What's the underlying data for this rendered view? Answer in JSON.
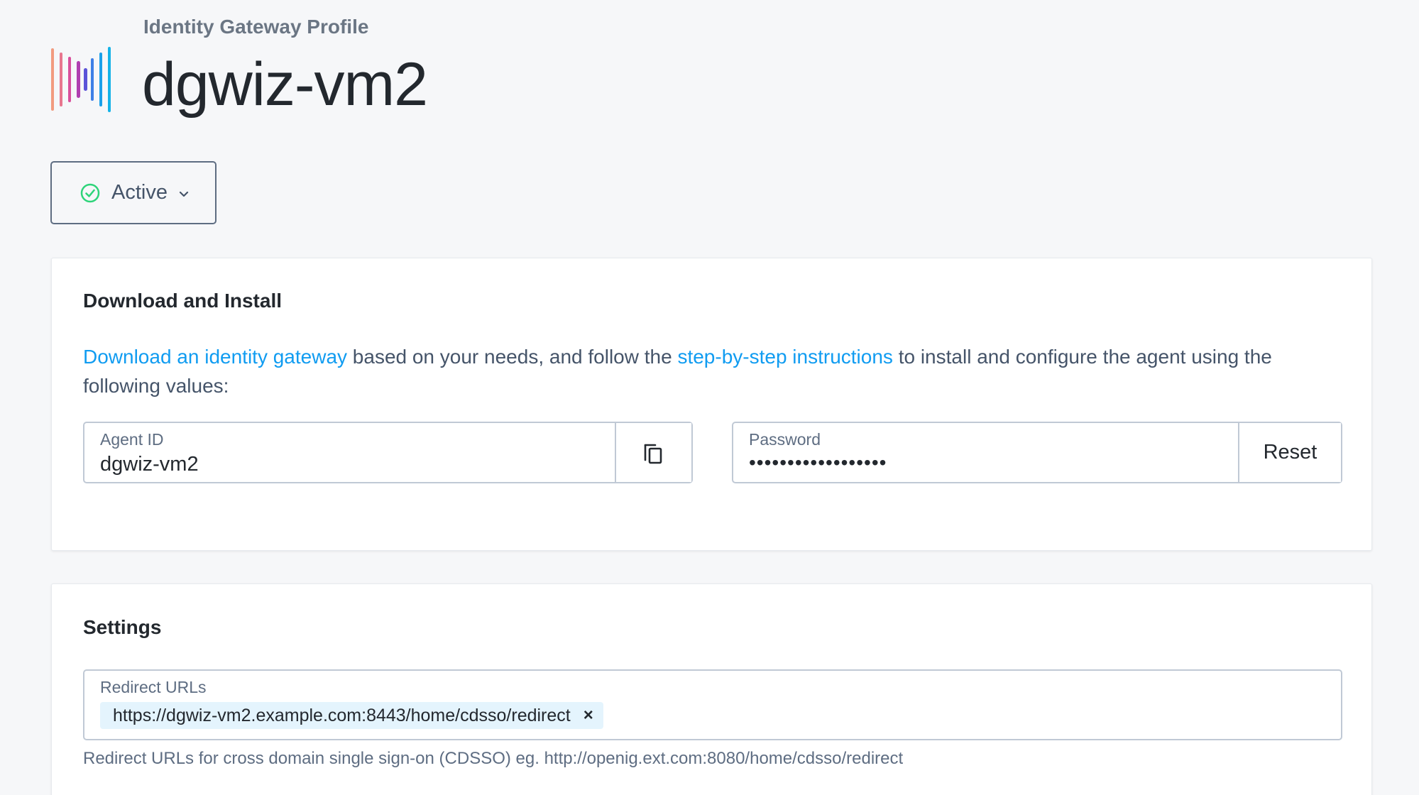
{
  "header": {
    "subtitle": "Identity Gateway Profile",
    "title": "dgwiz-vm2",
    "logo_icon": "forgerock-logo-icon"
  },
  "status": {
    "label": "Active",
    "icon": "check-circle-icon",
    "icon_color": "#2ed47a",
    "dropdown_icon": "chevron-down-icon"
  },
  "download_card": {
    "title": "Download and Install",
    "description": {
      "link1": "Download an identity gateway",
      "text1": " based on your needs, and follow the ",
      "link2": "step-by-step instructions",
      "text2": " to install and configure the agent using the following values:"
    },
    "agent_id": {
      "label": "Agent ID",
      "value": "dgwiz-vm2",
      "copy_icon": "copy-icon"
    },
    "password": {
      "label": "Password",
      "value": "••••••••••••••••••",
      "reset_label": "Reset"
    }
  },
  "settings_card": {
    "title": "Settings",
    "redirect_urls": {
      "label": "Redirect URLs",
      "chips": [
        "https://dgwiz-vm2.example.com:8443/home/cdsso/redirect"
      ],
      "remove_symbol": "×",
      "help_text": "Redirect URLs for cross domain single sign-on (CDSSO) eg. http://openig.ext.com:8080/home/cdsso/redirect"
    }
  },
  "colors": {
    "link": "#109cf1",
    "chip_bg": "#e4f4fd",
    "success": "#2ed47a"
  }
}
